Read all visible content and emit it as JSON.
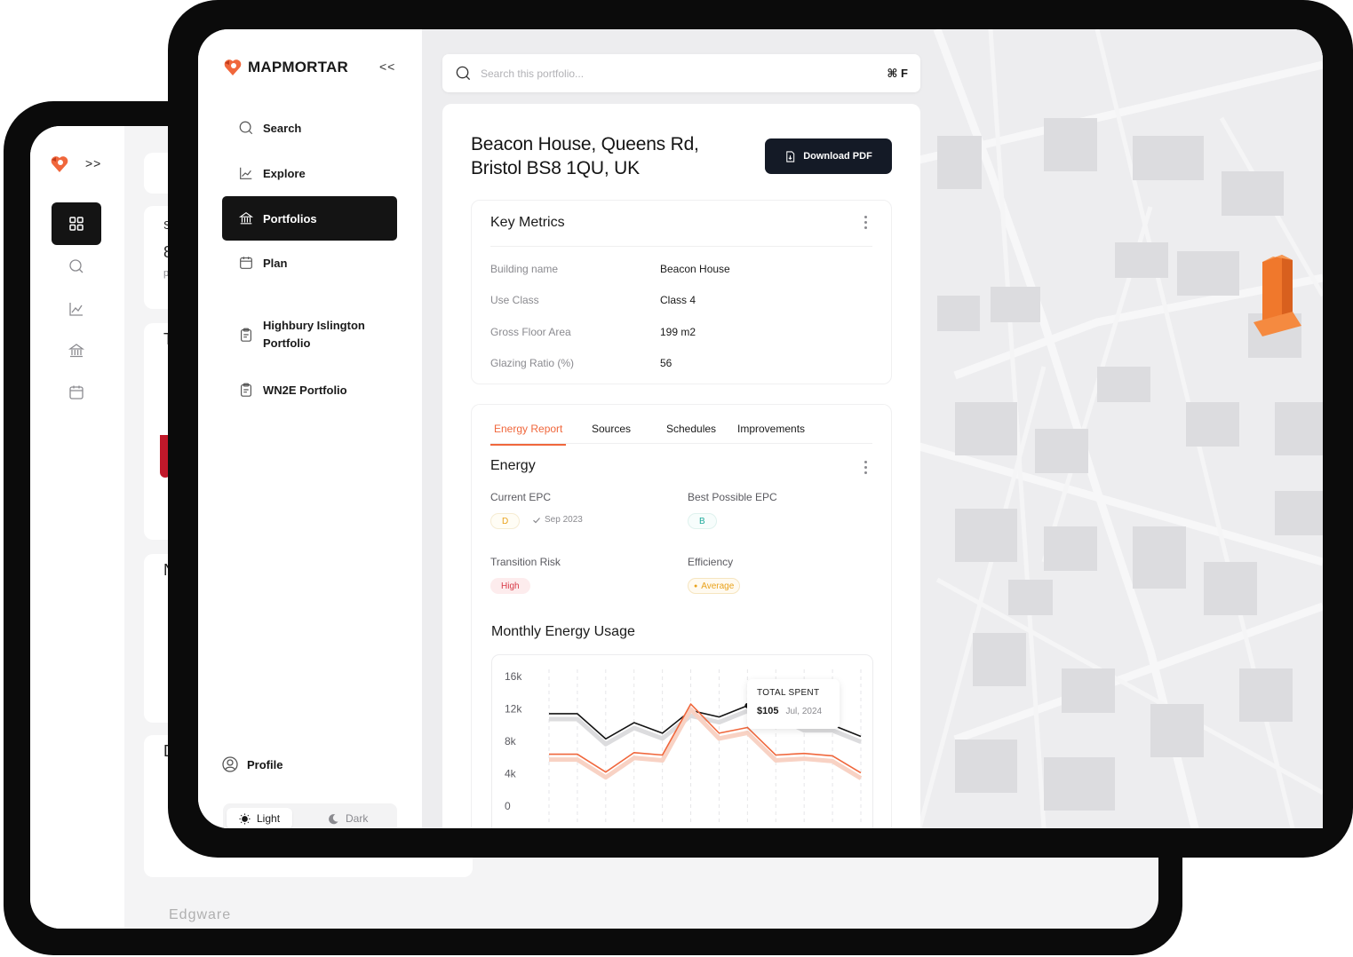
{
  "brand": {
    "name_left": "MAP",
    "name_right": "MORTAR",
    "accent_color": "#f0673c"
  },
  "sidebar": {
    "collapse_label": "<<",
    "items": [
      {
        "label": "Search",
        "icon": "search-icon"
      },
      {
        "label": "Explore",
        "icon": "chart-line-icon"
      },
      {
        "label": "Portfolios",
        "icon": "bank-icon",
        "active": true
      },
      {
        "label": "Plan",
        "icon": "calendar-icon"
      }
    ],
    "portfolios": [
      {
        "label": "Highbury Islington Portfolio",
        "icon": "clipboard-icon"
      },
      {
        "label": "WN2E Portfolio",
        "icon": "clipboard-icon"
      }
    ],
    "profile_label": "Profile",
    "theme": {
      "light": "Light",
      "dark": "Dark",
      "selected": "Light"
    }
  },
  "back_sidebar": {
    "expand_label": ">>"
  },
  "back_map": {
    "label": "Edgware"
  },
  "back_cards": {
    "letters": [
      "S",
      "8",
      "p",
      "T",
      "N",
      "D"
    ]
  },
  "search": {
    "placeholder": "Search this portfolio...",
    "shortcut": "⌘ F"
  },
  "property": {
    "address": "Beacon House, Queens Rd, Bristol BS8 1QU, UK",
    "download_label": "Download PDF"
  },
  "key_metrics": {
    "title": "Key Metrics",
    "rows": [
      {
        "label": "Building name",
        "value": "Beacon House"
      },
      {
        "label": "Use Class",
        "value": "Class 4"
      },
      {
        "label": "Gross Floor Area",
        "value": "199 m2"
      },
      {
        "label": "Glazing Ratio (%)",
        "value": "56"
      }
    ]
  },
  "tabs": [
    "Energy Report",
    "Sources",
    "Schedules",
    "Improvements"
  ],
  "energy": {
    "title": "Energy",
    "current_epc_label": "Current EPC",
    "current_epc": "D",
    "current_epc_date": "Sep 2023",
    "best_epc_label": "Best Possible EPC",
    "best_epc": "B",
    "transition_risk_label": "Transition Risk",
    "transition_risk": "High",
    "efficiency_label": "Efficiency",
    "efficiency": "Average",
    "colors": {
      "epc_d": "#e9a21b",
      "epc_b": "#1ea99a",
      "high": "#d83b48"
    }
  },
  "chart_data": {
    "type": "line",
    "title": "Monthly Energy Usage",
    "ylim": [
      0,
      16000
    ],
    "y_ticks": [
      "16k",
      "12k",
      "8k",
      "4k",
      "0"
    ],
    "grid": "vertical dashed",
    "x": [
      1,
      2,
      3,
      4,
      5,
      6,
      7,
      8,
      9,
      10,
      11,
      12
    ],
    "series": [
      {
        "color": "#141414",
        "values": [
          11400,
          11400,
          8300,
          10300,
          9000,
          11800,
          11000,
          12400,
          11700,
          10000,
          10000,
          8600
        ]
      },
      {
        "color": "#f0673c",
        "values": [
          6400,
          6400,
          4200,
          6600,
          6300,
          12600,
          9000,
          9700,
          6300,
          6500,
          6200,
          4100
        ]
      }
    ],
    "tooltip": {
      "title": "TOTAL SPENT",
      "value": "$105",
      "date": "Jul, 2024"
    }
  }
}
